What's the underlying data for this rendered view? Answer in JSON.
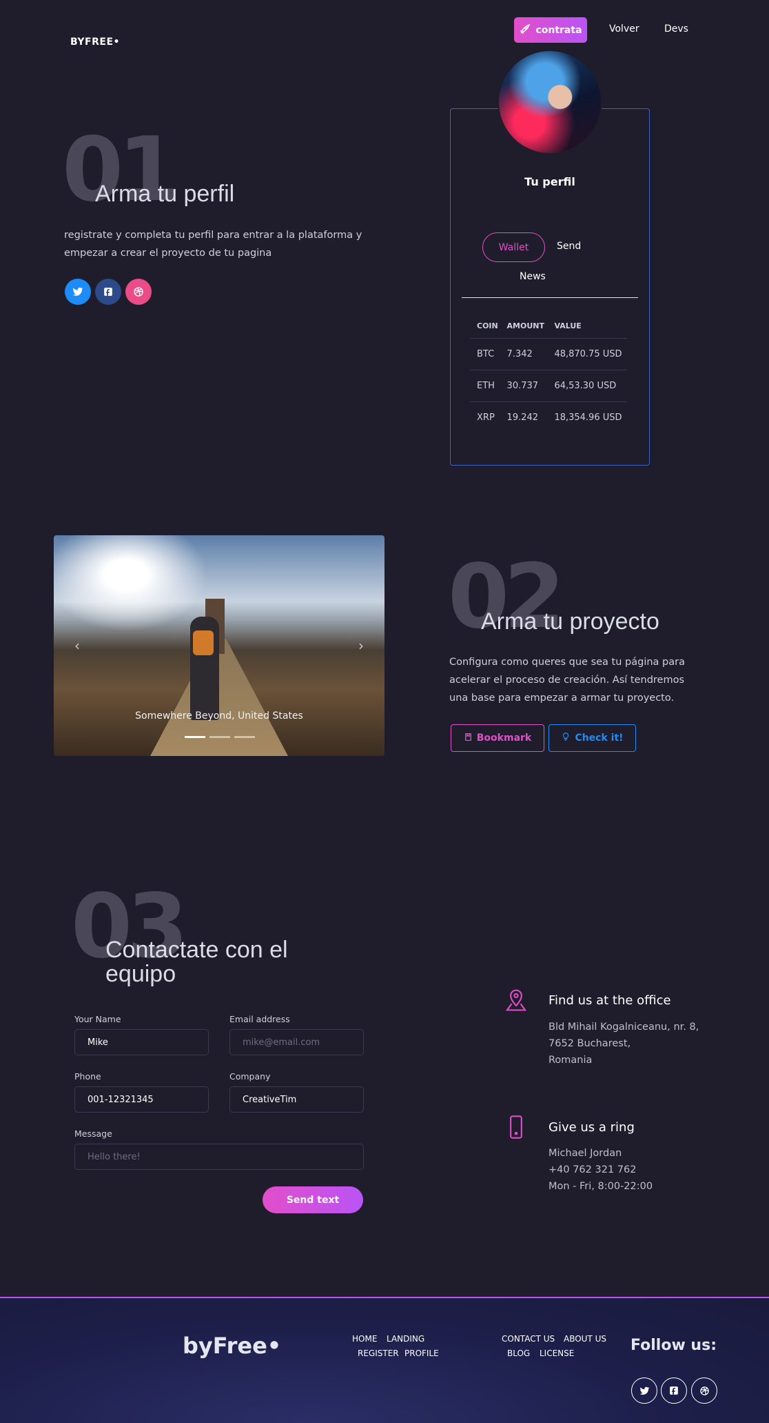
{
  "nav": {
    "brand": "BYFREE•",
    "cta_label": "contrata",
    "links": [
      "Volver",
      "Devs"
    ]
  },
  "section1": {
    "number": "01",
    "title": "Arma tu perfil",
    "description": "registrate y completa tu perfil para entrar a la plataforma y empezar a crear el proyecto de tu pagina",
    "socials": [
      "twitter-icon",
      "facebook-icon",
      "dribbble-icon"
    ]
  },
  "profile_card": {
    "title": "Tu perfil",
    "tabs": [
      "Wallet",
      "Send",
      "News"
    ],
    "active_tab": "Wallet",
    "table": {
      "headers": [
        "COIN",
        "AMOUNT",
        "VALUE"
      ],
      "rows": [
        [
          "BTC",
          "7.342",
          "48,870.75 USD"
        ],
        [
          "ETH",
          "30.737",
          "64,53.30 USD"
        ],
        [
          "XRP",
          "19.242",
          "18,354.96 USD"
        ]
      ]
    }
  },
  "carousel": {
    "caption": "Somewhere Beyond, United States"
  },
  "section2": {
    "number": "02",
    "title": "Arma tu proyecto",
    "description": "Configura como queres que sea tu página para acelerar el proceso de creación. Así tendremos una base para empezar a armar tu proyecto.",
    "bookmark_label": "Bookmark",
    "check_label": "Check it!"
  },
  "section3": {
    "number": "03",
    "title_line1": "Contactate con el",
    "title_line2": "equipo"
  },
  "form": {
    "name_label": "Your Name",
    "name_value": "Mike",
    "email_label": "Email address",
    "email_placeholder": "mike@email.com",
    "phone_label": "Phone",
    "phone_value": "001-12321345",
    "company_label": "Company",
    "company_value": "CreativeTim",
    "message_label": "Message",
    "message_placeholder": "Hello there!",
    "send_label": "Send text"
  },
  "contact_info": {
    "office_title": "Find us at the office",
    "office_lines": [
      "Bld Mihail Kogalniceanu, nr. 8,",
      "7652 Bucharest,",
      "Romania"
    ],
    "ring_title": "Give us a ring",
    "ring_lines": [
      "Michael Jordan",
      "+40 762 321 762",
      "Mon - Fri, 8:00-22:00"
    ]
  },
  "footer": {
    "logo": "byFree•",
    "links_col1": [
      "HOME",
      "LANDING",
      "REGISTER",
      "PROFILE"
    ],
    "links_col2": [
      "CONTACT US",
      "ABOUT US",
      "BLOG",
      "LICENSE"
    ],
    "follow_label": "Follow us:"
  },
  "colors": {
    "accent": "#e14eca",
    "accent2": "#ba54f5",
    "info": "#1d8cf8",
    "background": "#1f1d2b",
    "twitter": "#1d8cf8",
    "facebook": "#3b5998",
    "dribbble": "#ea4c89"
  }
}
